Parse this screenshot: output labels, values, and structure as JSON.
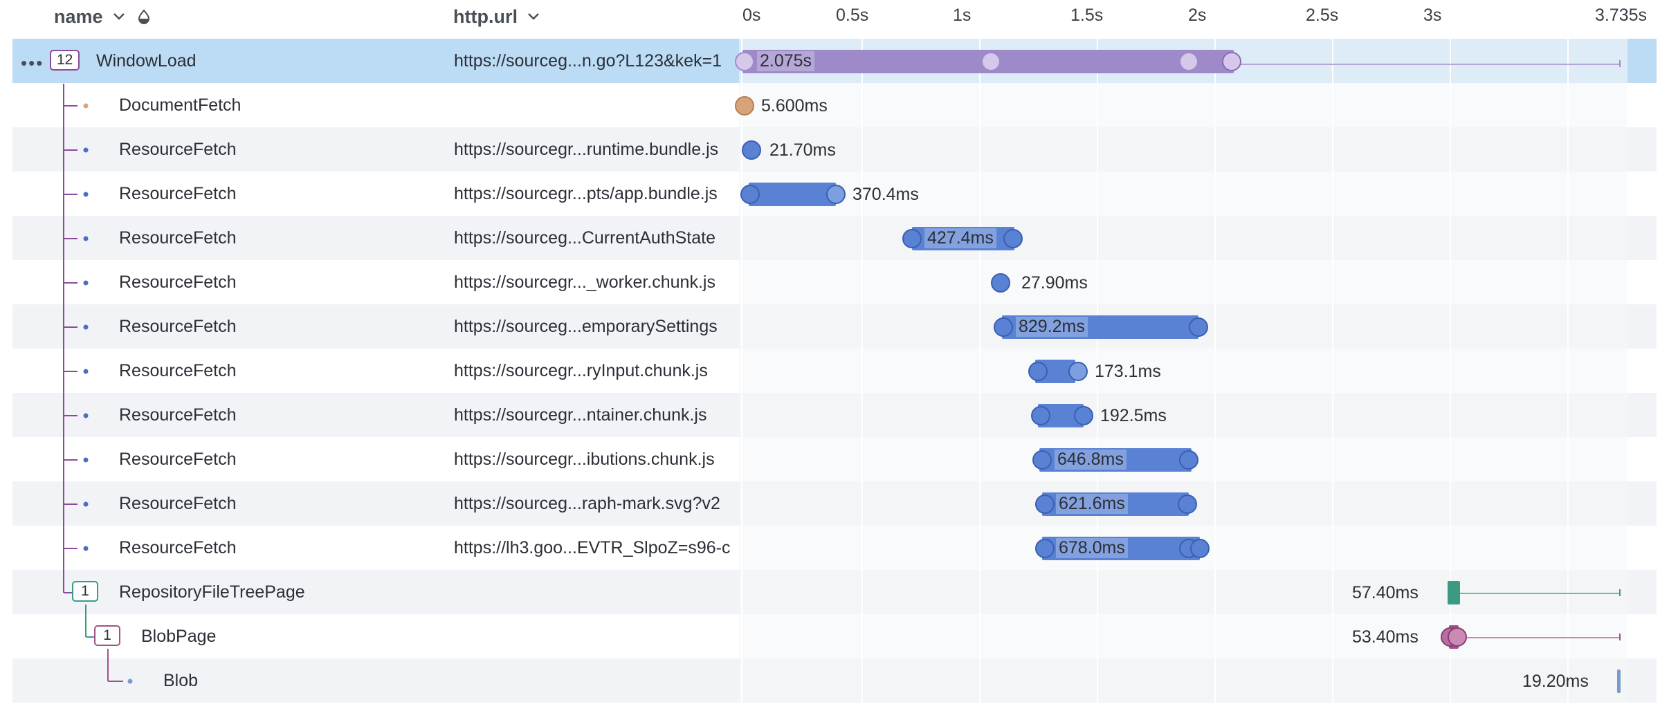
{
  "header": {
    "name_label": "name",
    "url_label": "http.url",
    "ticks": [
      "0s",
      "0.5s",
      "1s",
      "1.5s",
      "2s",
      "2.5s",
      "3s",
      "3.735s"
    ]
  },
  "colors": {
    "selected_row": "#bcdcf5",
    "window_bar": "#9e8ac8",
    "resource_bar": "#5a82d4",
    "document": "#d7a37a",
    "repo": "#3d9a82",
    "blob_page": "#a2508a",
    "blob": "#7a9ad0"
  },
  "icons": [
    "more-icon",
    "chevron-down-icon",
    "sort-icon"
  ],
  "rows": [
    {
      "name": "WindowLoad",
      "url": "https://sourceg...n.go?L123&kek=1",
      "duration": "2.075s",
      "count": "12"
    },
    {
      "name": "DocumentFetch",
      "url": "",
      "duration": "5.600ms"
    },
    {
      "name": "ResourceFetch",
      "url": "https://sourcegr...runtime.bundle.js",
      "duration": "21.70ms"
    },
    {
      "name": "ResourceFetch",
      "url": "https://sourcegr...pts/app.bundle.js",
      "duration": "370.4ms"
    },
    {
      "name": "ResourceFetch",
      "url": "https://sourceg...CurrentAuthState",
      "duration": "427.4ms"
    },
    {
      "name": "ResourceFetch",
      "url": "https://sourcegr..._worker.chunk.js",
      "duration": "27.90ms"
    },
    {
      "name": "ResourceFetch",
      "url": "https://sourceg...emporarySettings",
      "duration": "829.2ms"
    },
    {
      "name": "ResourceFetch",
      "url": "https://sourcegr...ryInput.chunk.js",
      "duration": "173.1ms"
    },
    {
      "name": "ResourceFetch",
      "url": "https://sourcegr...ntainer.chunk.js",
      "duration": "192.5ms"
    },
    {
      "name": "ResourceFetch",
      "url": "https://sourcegr...ibutions.chunk.js",
      "duration": "646.8ms"
    },
    {
      "name": "ResourceFetch",
      "url": "https://sourceg...raph-mark.svg?v2",
      "duration": "621.6ms"
    },
    {
      "name": "ResourceFetch",
      "url": "https://lh3.goo...EVTR_SlpoZ=s96-c",
      "duration": "678.0ms"
    },
    {
      "name": "RepositoryFileTreePage",
      "url": "",
      "duration": "57.40ms",
      "count": "1"
    },
    {
      "name": "BlobPage",
      "url": "",
      "duration": "53.40ms",
      "count": "1"
    },
    {
      "name": "Blob",
      "url": "",
      "duration": "19.20ms"
    }
  ]
}
